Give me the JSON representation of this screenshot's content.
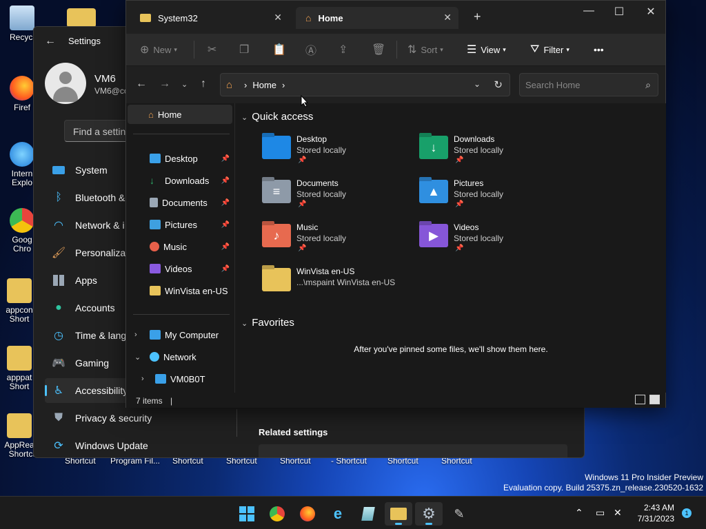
{
  "desktop": {
    "icons": [
      {
        "label": "Recycl",
        "color": "#9fc5e8"
      },
      {
        "label": "Firef",
        "color": "#ff7b20"
      },
      {
        "label": "Intern Explo",
        "color": "#2b8fe8"
      },
      {
        "label": "Goog Chro",
        "color": "#e8453c"
      },
      {
        "label": "appcon Short",
        "color": "#e8c35a"
      },
      {
        "label": "apppat Short",
        "color": "#e8c35a"
      },
      {
        "label": "AppRead - Shortcut",
        "color": "#e8c35a"
      }
    ],
    "shortcut_labels": [
      "Shortcut",
      "Program Fil...",
      "Shortcut",
      "Shortcut",
      "Shortcut",
      "- Shortcut",
      "Shortcut",
      "Shortcut"
    ]
  },
  "settings": {
    "title": "Settings",
    "user_name": "VM6",
    "user_email": "VM6@co",
    "find_placeholder": "Find a setting",
    "nav": [
      {
        "label": "System",
        "icon": "monitor-icon"
      },
      {
        "label": "Bluetooth &",
        "icon": "bluetooth-icon"
      },
      {
        "label": "Network & i",
        "icon": "wifi-icon"
      },
      {
        "label": "Personalizat",
        "icon": "brush-icon"
      },
      {
        "label": "Apps",
        "icon": "apps-icon"
      },
      {
        "label": "Accounts",
        "icon": "person-icon"
      },
      {
        "label": "Time & lang",
        "icon": "clock-icon"
      },
      {
        "label": "Gaming",
        "icon": "gamepad-icon"
      },
      {
        "label": "Accessibility",
        "icon": "accessibility-icon",
        "active": true
      },
      {
        "label": "Privacy & security",
        "icon": "shield-icon"
      },
      {
        "label": "Windows Update",
        "icon": "update-icon"
      }
    ],
    "related": "Related settings"
  },
  "explorer": {
    "tabs": [
      {
        "label": "System32",
        "active": false
      },
      {
        "label": "Home",
        "active": true
      }
    ],
    "new_tab": "+",
    "toolbar": {
      "new": "New",
      "sort": "Sort",
      "view": "View",
      "filter": "Filter",
      "more": "•••"
    },
    "address": {
      "crumb": "Home"
    },
    "search_placeholder": "Search Home",
    "sidebar": {
      "home": "Home",
      "pinned": [
        {
          "label": "Desktop",
          "color": "#3aa0e8"
        },
        {
          "label": "Downloads",
          "color": "#2fb36b"
        },
        {
          "label": "Documents",
          "color": "#9aa7b5"
        },
        {
          "label": "Pictures",
          "color": "#3ea0e0"
        },
        {
          "label": "Music",
          "color": "#e8604a"
        },
        {
          "label": "Videos",
          "color": "#8a5ae0"
        }
      ],
      "winvista": "WinVista en-US",
      "tree": [
        {
          "label": "My Computer",
          "expanded": false
        },
        {
          "label": "Network",
          "expanded": true
        },
        {
          "label": "VM0B0T",
          "expanded": false
        }
      ]
    },
    "quick_access_title": "Quick access",
    "quick_access": [
      {
        "name": "Desktop",
        "sub": "Stored locally",
        "color": "#1e88e5"
      },
      {
        "name": "Downloads",
        "sub": "Stored locally",
        "color": "#18a06a"
      },
      {
        "name": "Documents",
        "sub": "Stored locally",
        "color": "#8e9aa8"
      },
      {
        "name": "Pictures",
        "sub": "Stored locally",
        "color": "#2f8fe0"
      },
      {
        "name": "Music",
        "sub": "Stored locally",
        "color": "#e76a4f"
      },
      {
        "name": "Videos",
        "sub": "Stored locally",
        "color": "#8656d8"
      },
      {
        "name": "WinVista en-US",
        "sub": "...\\mspaint WinVista en-US",
        "color": "#e8c35a"
      }
    ],
    "favorites_title": "Favorites",
    "favorites_empty": "After you've pinned some files, we'll show them here.",
    "status": "7 items"
  },
  "watermark": {
    "line1": "Windows 11 Pro Insider Preview",
    "line2": "Evaluation copy. Build 25375.zn_release.230520-1632"
  },
  "taskbar": {
    "time": "2:43 AM",
    "date": "7/31/2023",
    "notifications": "1"
  }
}
